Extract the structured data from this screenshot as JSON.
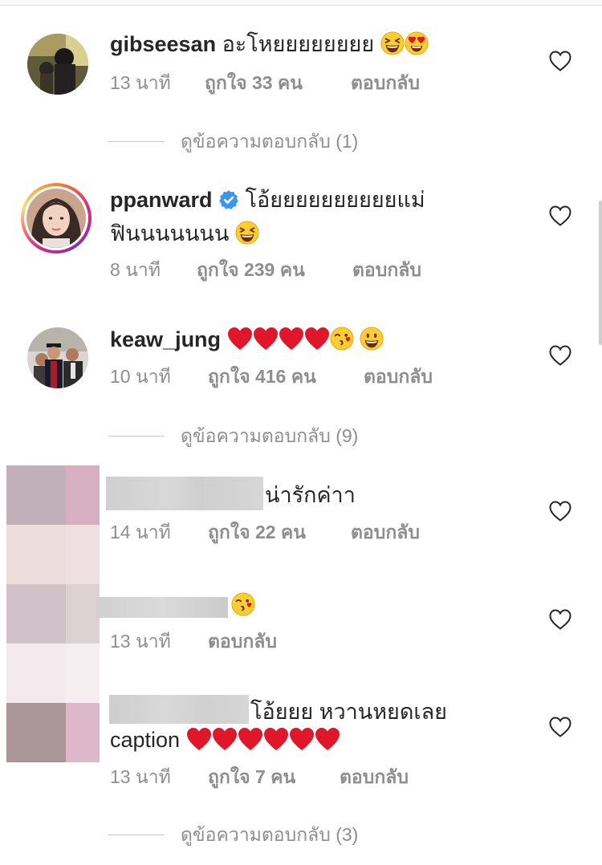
{
  "comments": [
    {
      "username": "gibseesan",
      "text": "อะโหยยยยยยยย",
      "time": "13 นาที",
      "likes": "ถูกใจ 33 คน",
      "reply": "ตอบกลับ",
      "view_replies": "ดูข้อความตอบกลับ (1)"
    },
    {
      "username": "ppanward",
      "verified": true,
      "text_line1": "โอ้ยยยยยยยยยยแม่",
      "text_line2": "ฟินนนนนนน",
      "time": "8 นาที",
      "likes": "ถูกใจ 239 คน",
      "reply": "ตอบกลับ"
    },
    {
      "username": "keaw_jung",
      "time": "10 นาที",
      "likes": "ถูกใจ 416 คน",
      "reply": "ตอบกลับ",
      "view_replies": "ดูข้อความตอบกลับ (9)"
    },
    {
      "text": "น่ารักค่าา",
      "time": "14 นาที",
      "likes": "ถูกใจ 22 คน",
      "reply": "ตอบกลับ"
    },
    {
      "time": "13 นาที",
      "reply": "ตอบกลับ"
    },
    {
      "text_line1": "โอ้ยยย หวานหยดเลย",
      "text_line2": "caption",
      "time": "13 นาที",
      "likes": "ถูกใจ 7 คน",
      "reply": "ตอบกลับ",
      "view_replies": "ดูข้อความตอบกลับ (3)"
    }
  ],
  "colors": {
    "text": "#262626",
    "secondary": "#8e8e8e",
    "heart_red": "#e0162b",
    "verified_blue": "#3897f0"
  },
  "icons": [
    "heart-outline-icon",
    "verified-badge-icon",
    "red-heart-emoji",
    "laughing-emoji",
    "heart-eyes-emoji",
    "kissing-emoji",
    "grinning-emoji"
  ]
}
